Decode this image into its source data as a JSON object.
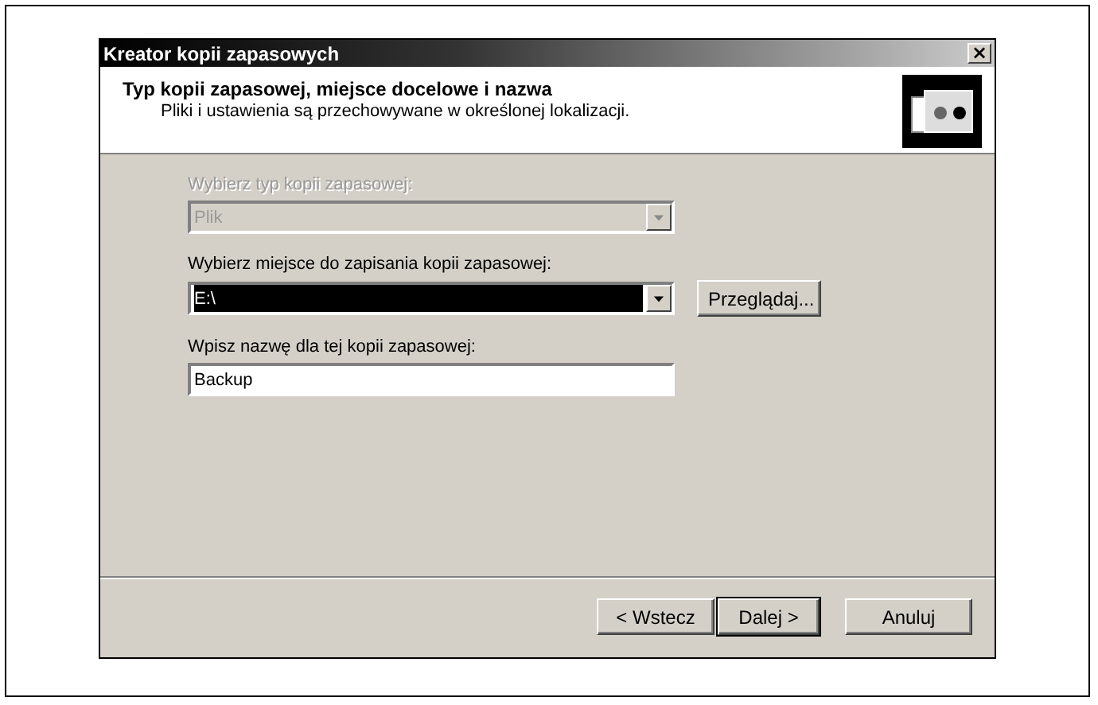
{
  "window": {
    "title": "Kreator kopii zapasowych",
    "close": "×"
  },
  "header": {
    "title": "Typ kopii zapasowej, miejsce docelowe i nazwa",
    "subtitle": "Pliki i ustawienia są przechowywane w określonej lokalizacji."
  },
  "fields": [
    {
      "kind": "combo",
      "label": "Wybierz typ kopii zapasowej:",
      "value": "Plik",
      "disabled": true,
      "focused": false
    },
    {
      "kind": "combo",
      "label": "Wybierz miejsce do zapisania kopii zapasowej:",
      "value": "E:\\",
      "disabled": false,
      "focused": true,
      "button": "Przeglądaj..."
    },
    {
      "kind": "text",
      "label": "Wpisz nazwę dla tej kopii zapasowej:",
      "value": "Backup",
      "disabled": false,
      "focused": false
    }
  ],
  "buttons": [
    {
      "label": "< Wstecz",
      "default": false
    },
    {
      "label": "Dalej >",
      "default": true
    },
    {
      "label": "Anuluj",
      "default": false
    }
  ]
}
